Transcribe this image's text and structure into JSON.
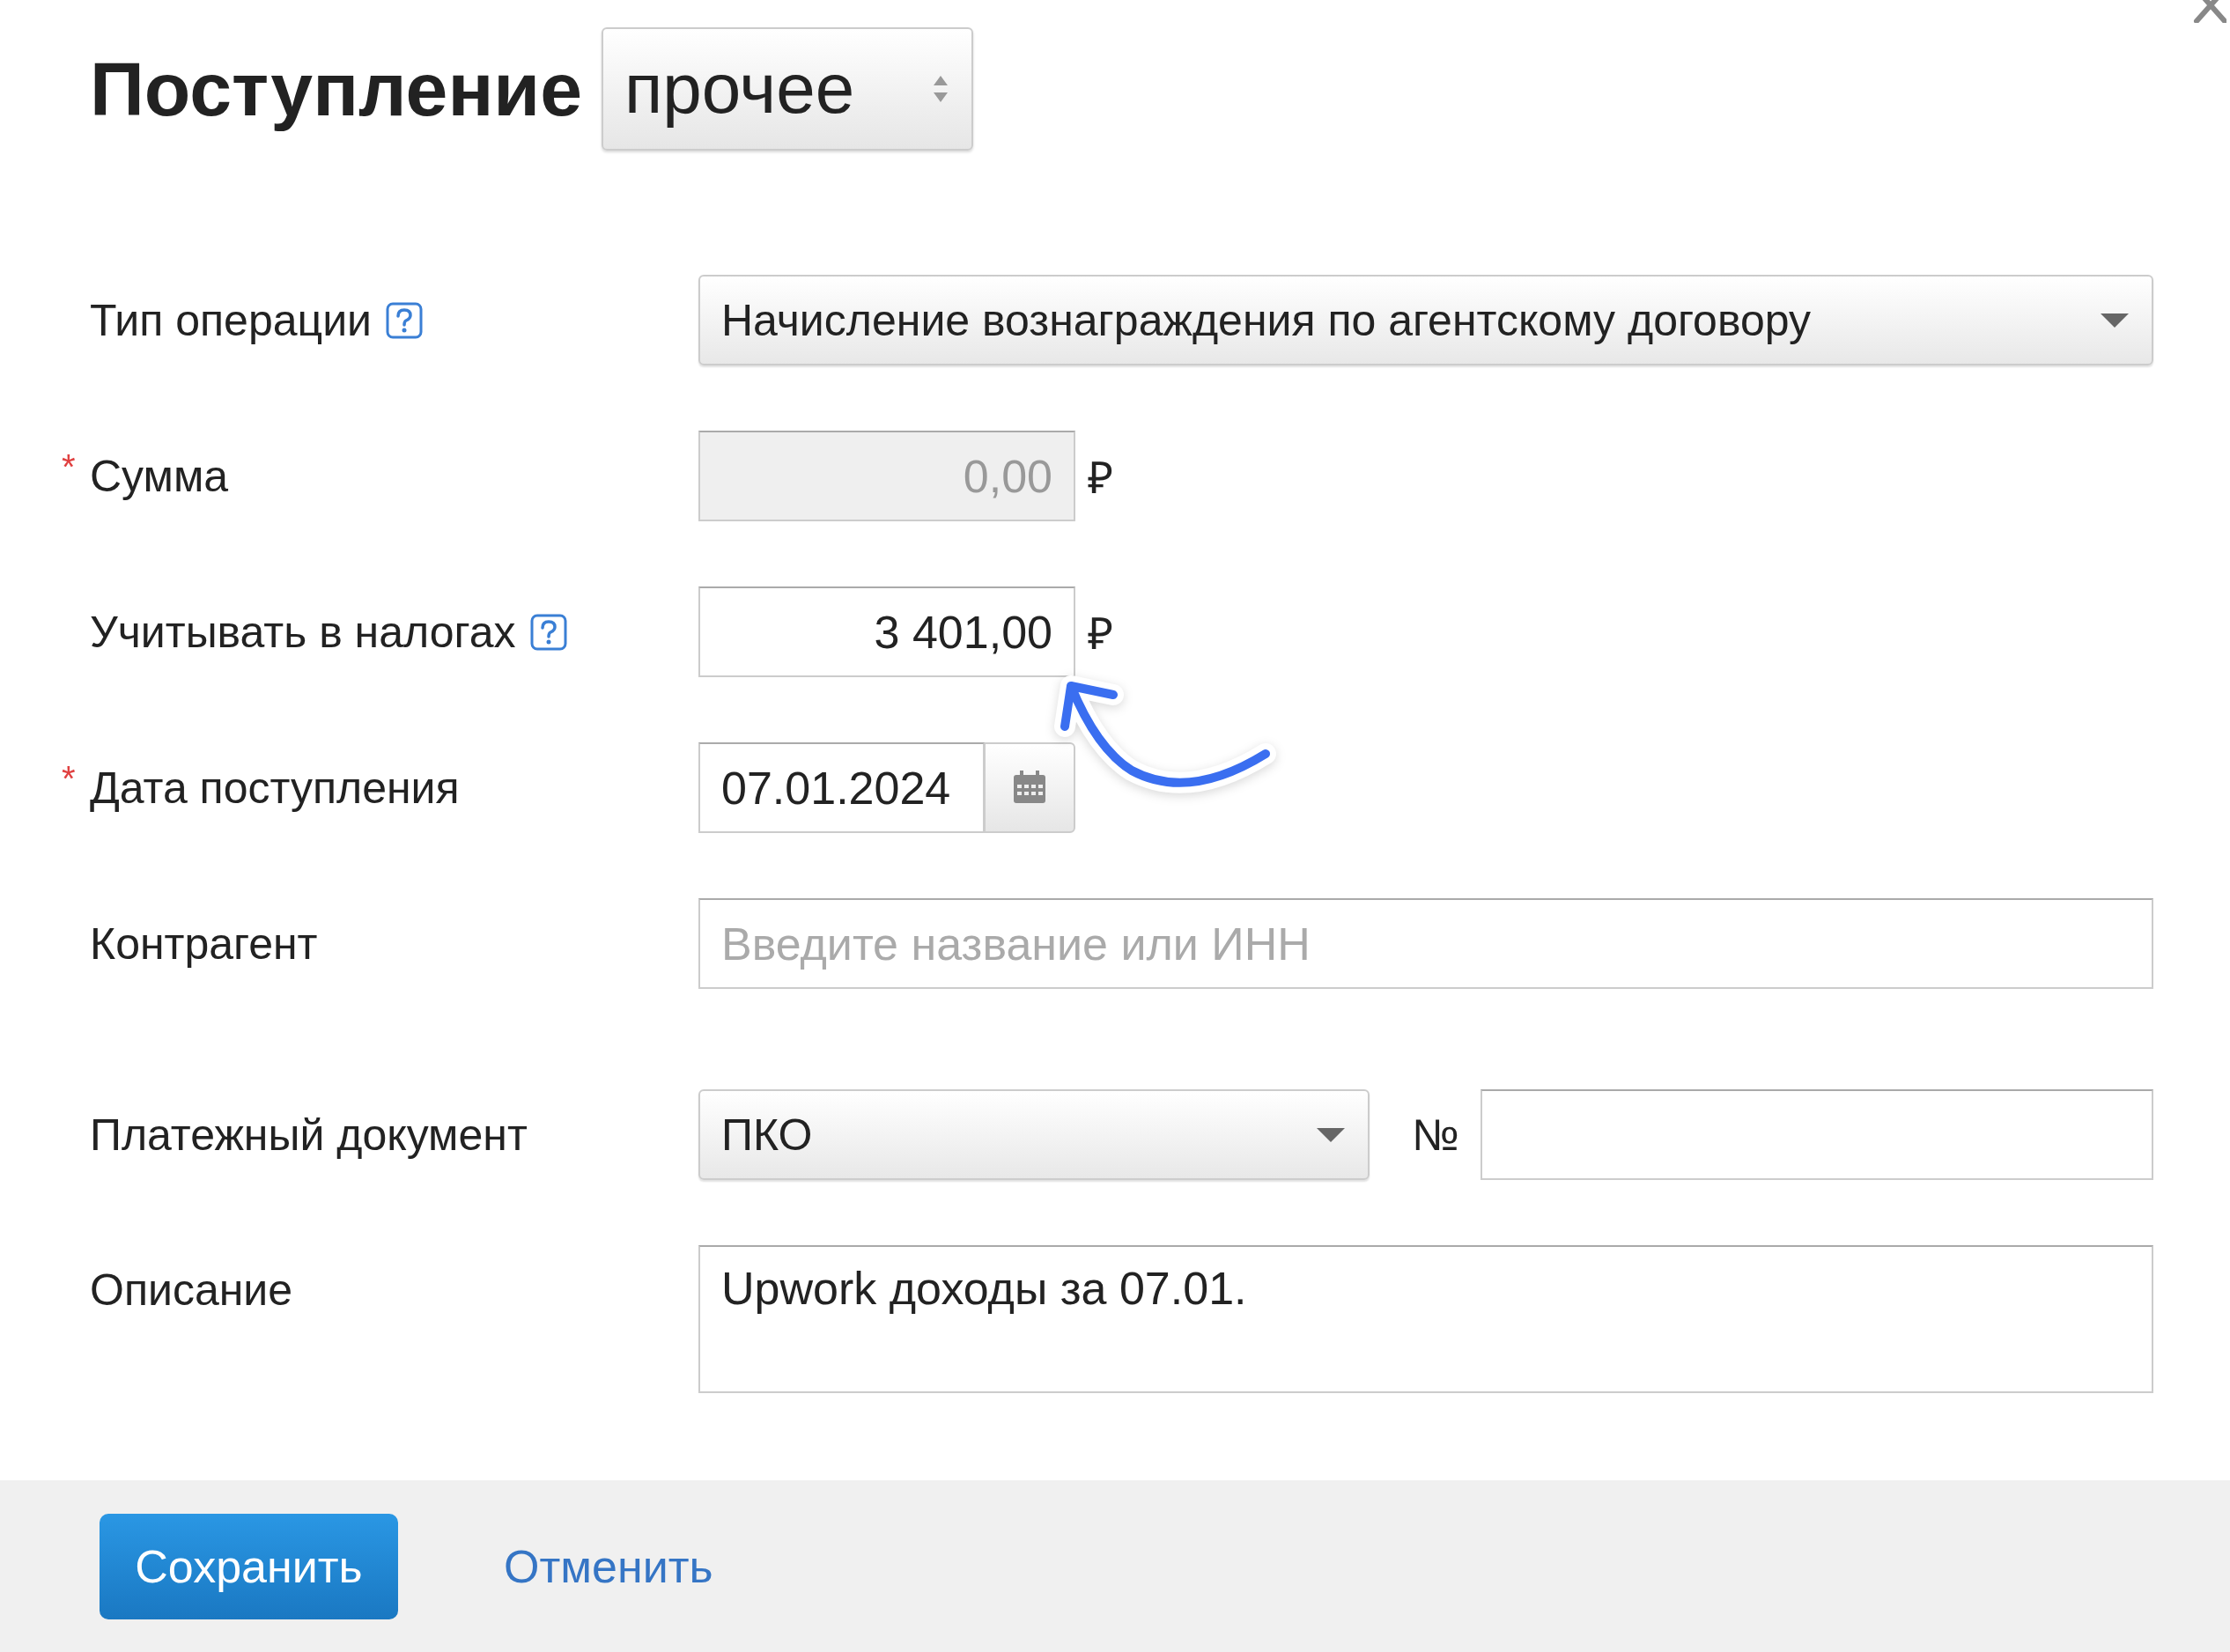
{
  "dialog": {
    "title": "Поступление",
    "type_select": {
      "value": "прочее"
    }
  },
  "fields": [
    {
      "kind": "select",
      "label": "Тип операции",
      "help": true,
      "value": "Начисление вознаграждения по агентскому договору"
    },
    {
      "kind": "amount",
      "label": "Сумма",
      "required_mark": "*",
      "help": false,
      "value": "0,00",
      "disabled": true,
      "currency": "₽"
    },
    {
      "kind": "amount",
      "label": "Учитывать в налогах",
      "help": true,
      "value": "3 401,00",
      "disabled": false,
      "currency": "₽"
    },
    {
      "kind": "date",
      "label": "Дата поступления",
      "required_mark": "*",
      "help": false,
      "value": "07.01.2024"
    },
    {
      "kind": "text",
      "label": "Контрагент",
      "help": false,
      "placeholder": "Введите название или ИНН"
    },
    {
      "kind": "document",
      "label": "Платежный документ",
      "help": false,
      "value": "ПКО",
      "number_label": "№"
    },
    {
      "kind": "textarea",
      "label": "Описание",
      "help": false,
      "value": "Upwork доходы за 07.01."
    }
  ],
  "footer": {
    "buttons": [
      {
        "kind": "primary",
        "label": "Сохранить"
      },
      {
        "kind": "link",
        "label": "Отменить"
      }
    ]
  }
}
